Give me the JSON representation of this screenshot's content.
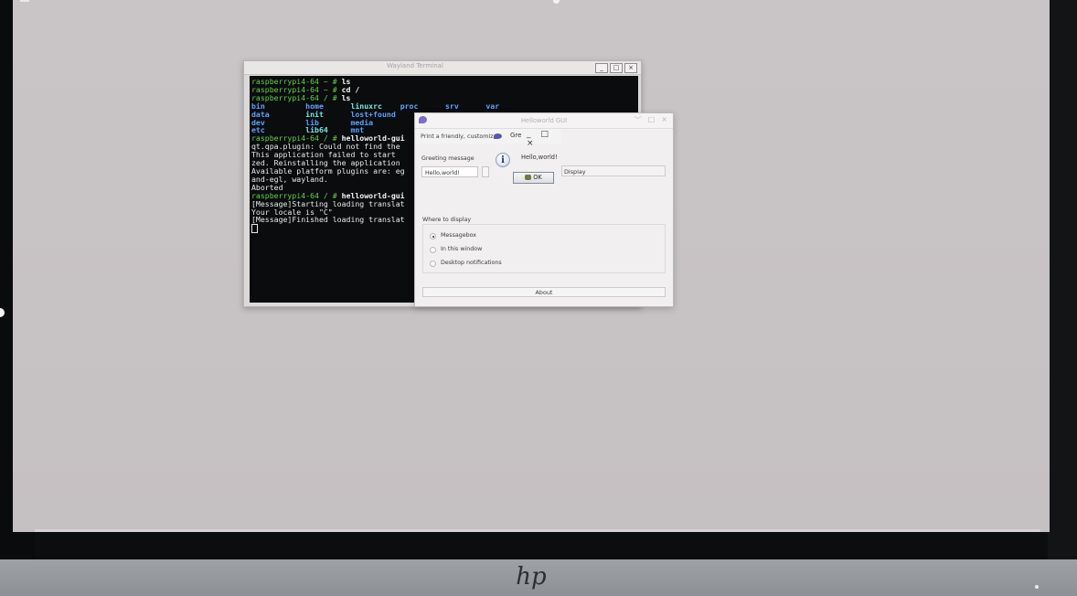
{
  "terminal": {
    "title": "Wayland Terminal",
    "buttons": [
      "_",
      "□",
      "×"
    ],
    "lines": [
      [
        {
          "t": "raspberrypi4-64 ~ # ",
          "c": "g"
        },
        {
          "t": "ls",
          "c": "w"
        }
      ],
      [
        {
          "t": "raspberrypi4-64 ~ # ",
          "c": "g"
        },
        {
          "t": "cd /",
          "c": "w"
        }
      ],
      [
        {
          "t": "raspberrypi4-64 / # ",
          "c": "g"
        },
        {
          "t": "ls",
          "c": "w"
        }
      ],
      [
        {
          "t": "bin         ",
          "c": "b"
        },
        {
          "t": "home      ",
          "c": "b"
        },
        {
          "t": "linuxrc    ",
          "c": "c"
        },
        {
          "t": "proc      ",
          "c": "b"
        },
        {
          "t": "srv      ",
          "c": "b"
        },
        {
          "t": "var",
          "c": "b"
        }
      ],
      [
        {
          "t": "data        ",
          "c": "b"
        },
        {
          "t": "init      ",
          "c": "c"
        },
        {
          "t": "lost+found",
          "c": "b"
        }
      ],
      [
        {
          "t": "dev         ",
          "c": "b"
        },
        {
          "t": "lib       ",
          "c": "b"
        },
        {
          "t": "media",
          "c": "b"
        }
      ],
      [
        {
          "t": "etc         ",
          "c": "b"
        },
        {
          "t": "lib64     ",
          "c": "c"
        },
        {
          "t": "mnt",
          "c": "b"
        }
      ],
      [
        {
          "t": "raspberrypi4-64 / # ",
          "c": "g"
        },
        {
          "t": "helloworld-gui",
          "c": "w"
        }
      ],
      [
        {
          "t": "qt.qpa.plugin: Could not find the",
          "c": ""
        }
      ],
      [
        {
          "t": "This application failed to start",
          "c": ""
        }
      ],
      [
        {
          "t": "zed. Reinstalling the application",
          "c": ""
        }
      ],
      [
        {
          "t": "",
          "c": ""
        }
      ],
      [
        {
          "t": "Available platform plugins are: eg",
          "c": ""
        }
      ],
      [
        {
          "t": "and-egl, wayland.",
          "c": ""
        }
      ],
      [
        {
          "t": "",
          "c": ""
        }
      ],
      [
        {
          "t": "Aborted",
          "c": ""
        }
      ],
      [
        {
          "t": "raspberrypi4-64 / # ",
          "c": "g"
        },
        {
          "t": "helloworld-gui",
          "c": "w"
        }
      ],
      [
        {
          "t": "[Message]Starting loading translat",
          "c": ""
        }
      ],
      [
        {
          "t": "Your locale is \"C\"",
          "c": ""
        }
      ],
      [
        {
          "t": "[Message]Finished loading translat",
          "c": ""
        }
      ]
    ]
  },
  "qt_window": {
    "title": "Helloworld GUI",
    "buttons": [
      "﹀",
      "□",
      "×"
    ],
    "tooltip": {
      "text": "Print a friendly, customiz",
      "title": "Gre",
      "buttons": "_ □ ×"
    },
    "greeting_label": "Greeting message",
    "greeting_value": "Hello,world!",
    "info_glyph": "i",
    "message": "Hello,world!",
    "ok_label": "OK",
    "display_placeholder": "Display",
    "where_label": "Where to display",
    "options": [
      {
        "label": "Messagebox",
        "selected": true
      },
      {
        "label": "In this window",
        "selected": false
      },
      {
        "label": "Desktop notifications",
        "selected": false
      }
    ],
    "about_label": "About"
  },
  "monitor": {
    "brand": "hp"
  }
}
